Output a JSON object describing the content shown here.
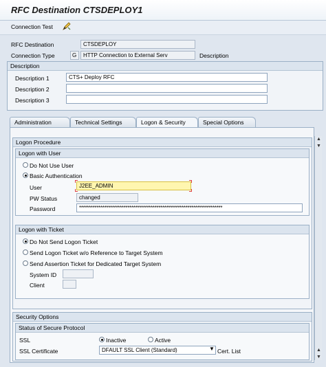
{
  "window": {
    "title": "RFC Destination CTSDEPLOY1"
  },
  "toolbar": {
    "connection_test": "Connection Test",
    "edit_icon": "pencil-icon"
  },
  "header": {
    "rfc_destination_label": "RFC Destination",
    "rfc_destination_value": "CTSDEPLOY",
    "connection_type_label": "Connection Type",
    "connection_type_code": "G",
    "connection_type_value": "HTTP Connection to External Serv",
    "description_label": "Description"
  },
  "description_group": {
    "title": "Description",
    "desc1_label": "Description 1",
    "desc1_value": "CTS+ Deploy RFC",
    "desc2_label": "Description 2",
    "desc2_value": "",
    "desc3_label": "Description 3",
    "desc3_value": ""
  },
  "tabs": [
    "Administration",
    "Technical Settings",
    "Logon & Security",
    "Special Options"
  ],
  "active_tab": "Logon & Security",
  "logon_procedure": {
    "title": "Logon Procedure",
    "logon_with_user": {
      "title": "Logon with User",
      "option_no_user": "Do Not Use User",
      "option_basic": "Basic Authentication",
      "user_label": "User",
      "user_value": "J2EE_ADMIN",
      "pw_status_label": "PW Status",
      "pw_status_value": "changed",
      "password_label": "Password",
      "password_value": "**************************************************************************"
    },
    "logon_with_ticket": {
      "title": "Logon with Ticket",
      "opt1": "Do Not Send Logon Ticket",
      "opt2": "Send Logon Ticket w/o Reference to Target System",
      "opt3": "Send Assertion Ticket for Dedicated Target System",
      "system_id_label": "System ID",
      "client_label": "Client"
    }
  },
  "security_options": {
    "title": "Security Options",
    "status_title": "Status of Secure Protocol",
    "ssl_label": "SSL",
    "inactive_label": "Inactive",
    "active_label": "Active",
    "ssl_cert_label": "SSL Certificate",
    "ssl_cert_value": "DFAULT SSL Client (Standard)",
    "cert_list_label": "Cert. List"
  }
}
